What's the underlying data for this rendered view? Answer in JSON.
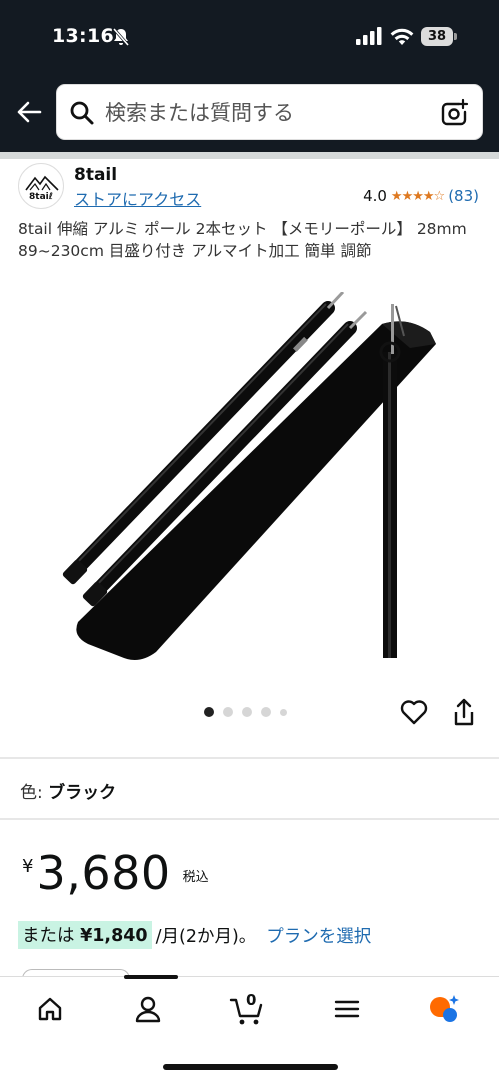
{
  "status_bar": {
    "time": "13:16",
    "battery": "38"
  },
  "header": {
    "search_placeholder": "検索または質問する"
  },
  "store": {
    "logo_text": "8taiℓ",
    "brand": "8tail",
    "link": "ストアにアクセス",
    "rating": "4.0",
    "stars": "★★★★☆",
    "review_count": "(83)"
  },
  "product": {
    "title": "8tail 伸縮 アルミ ポール 2本セット 【メモリーポール】 28mm 89~230cm 目盛り付き アルマイト加工 簡単 調節",
    "image_count": 5,
    "active_image_index": 0,
    "color_label": "色: ",
    "color_value": "ブラック",
    "currency": "¥",
    "price": "3,680",
    "tax_label": "税込",
    "installment_prefix": "または",
    "installment_amount": "¥1,840",
    "installment_suffix": "/月(2か月)。",
    "plan_link": "プランを選択"
  },
  "colors": {
    "header_bg": "#131a22",
    "link": "#1f6bb0",
    "star": "#de7921",
    "installment_highlight": "#c9f3e3"
  },
  "bottom_nav": {
    "items": [
      "home-icon",
      "account-icon",
      "cart-icon",
      "menu-icon",
      "rufus-ai-icon"
    ],
    "cart_count": "0"
  }
}
